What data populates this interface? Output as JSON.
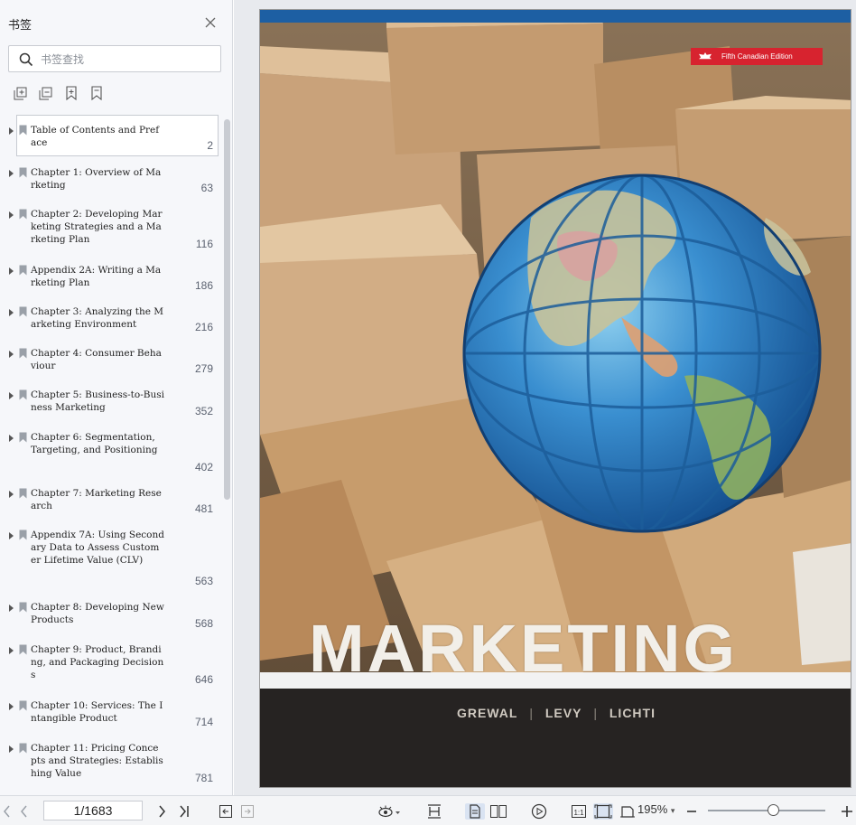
{
  "sidebar": {
    "title": "书签",
    "search_placeholder": "书签查找",
    "tools": [
      "expand-all-icon",
      "collapse-all-icon",
      "add-bookmark-icon",
      "bookmark-icon"
    ],
    "bookmarks": [
      {
        "label": "Table of Contents and Preface",
        "page": "2",
        "selected": true
      },
      {
        "label": "Chapter 1: Overview of Marketing",
        "page": "63"
      },
      {
        "label": "Chapter 2: Developing Marketing Strategies and a Marketing Plan",
        "page": "116"
      },
      {
        "label": "Appendix 2A: Writing a Marketing Plan",
        "page": "186"
      },
      {
        "label": "Chapter 3: Analyzing the Marketing Environment",
        "page": "216"
      },
      {
        "label": "Chapter 4: Consumer Behaviour",
        "page": "279"
      },
      {
        "label": "Chapter 5: Business-to-Business Marketing",
        "page": "352"
      },
      {
        "label": "Chapter 6: Segmentation, Targeting, and Positioning",
        "page": "402"
      },
      {
        "label": "Chapter 7: Marketing Research",
        "page": "481"
      },
      {
        "label": "Appendix 7A: Using Secondary Data to Assess Customer Lifetime Value (CLV)",
        "page": "563"
      },
      {
        "label": "Chapter 8: Developing New Products",
        "page": "568"
      },
      {
        "label": "Chapter 9: Product, Branding, and Packaging Decisions",
        "page": "646"
      },
      {
        "label": "Chapter 10: Services: The Intangible Product",
        "page": "714"
      },
      {
        "label": "Chapter 11: Pricing Concepts and Strategies: Establishing Value",
        "page": "781"
      }
    ]
  },
  "cover": {
    "edition": "Fifth Canadian Edition",
    "title": "MARKETING",
    "authors": [
      "GREWAL",
      "LEVY",
      "LICHTI"
    ]
  },
  "toolbar": {
    "page_indicator": "1/1683",
    "zoom": "195%",
    "zoom_fraction": 0.55
  },
  "colors": {
    "accent": "#1d5fa3",
    "edition_tag": "#d7232f",
    "sidebar_bg": "#f6f7fa"
  }
}
